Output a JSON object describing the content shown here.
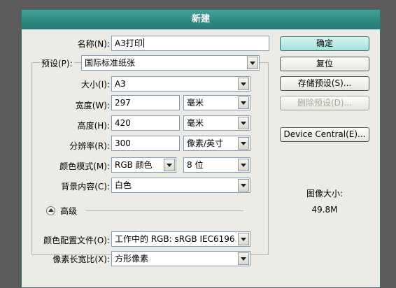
{
  "dialog": {
    "title": "新建"
  },
  "name": {
    "label": "名称(N):",
    "value": "A3打印"
  },
  "preset": {
    "label": "预设(P):",
    "value": "国际标准纸张"
  },
  "size": {
    "label": "大小(I):",
    "value": "A3"
  },
  "width": {
    "label": "宽度(W):",
    "value": "297",
    "unit": "毫米"
  },
  "height": {
    "label": "高度(H):",
    "value": "420",
    "unit": "毫米"
  },
  "resolution": {
    "label": "分辨率(R):",
    "value": "300",
    "unit": "像素/英寸"
  },
  "color_mode": {
    "label": "颜色模式(M):",
    "mode": "RGB 颜色",
    "depth": "8 位"
  },
  "background": {
    "label": "背景内容(C):",
    "value": "白色"
  },
  "advanced": {
    "label": "高级"
  },
  "color_profile": {
    "label": "颜色配置文件(O):",
    "value": "工作中的 RGB: sRGB IEC6196..."
  },
  "pixel_aspect": {
    "label": "像素长宽比(X):",
    "value": "方形像素"
  },
  "buttons": {
    "ok": "确定",
    "reset": "复位",
    "save_preset": "存储预设(S)...",
    "delete_preset": "删除预设(D)...",
    "device_central": "Device Central(E)..."
  },
  "image_size": {
    "label": "图像大小:",
    "value": "49.8M"
  },
  "colors": {
    "titlebar": "#2f8a82",
    "dialog_bg": "#ecebe5",
    "primary_button": "#a6e0da"
  }
}
